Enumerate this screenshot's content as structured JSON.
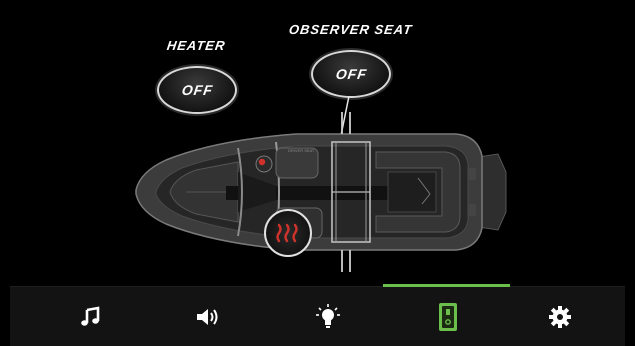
{
  "controls": {
    "heater": {
      "label": "HEATER",
      "state": "OFF"
    },
    "observer_seat": {
      "label": "OBSERVER SEAT",
      "state": "OFF"
    }
  },
  "nav": {
    "items": [
      {
        "name": "music",
        "icon": "music-note-icon"
      },
      {
        "name": "volume",
        "icon": "speaker-volume-icon"
      },
      {
        "name": "lights",
        "icon": "light-bulb-icon"
      },
      {
        "name": "switch",
        "icon": "power-switch-icon",
        "active": true
      },
      {
        "name": "settings",
        "icon": "gear-icon"
      }
    ]
  },
  "colors": {
    "background": "#000000",
    "accent": "#6bc04b",
    "heat_indicator": "#d0332b"
  }
}
